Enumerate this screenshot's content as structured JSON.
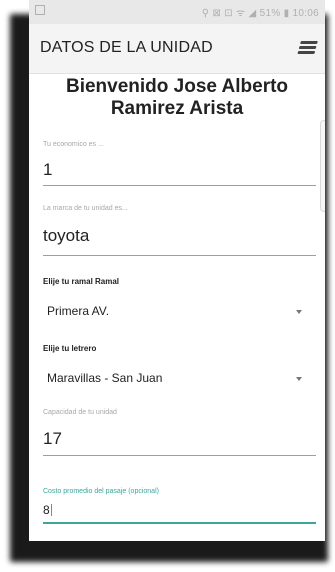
{
  "status_bar": {
    "right_text": "⚲ ⊠ ⊡ ᯤ ◢ 51% ▮ 10:06"
  },
  "app_bar": {
    "title": "DATOS DE LA UNIDAD",
    "menu_icon": "menu-icon"
  },
  "welcome": "Bienvenido Jose Alberto Ramirez Arista",
  "fields": {
    "economico": {
      "label": "Tu economico es ...",
      "value": "1"
    },
    "marca": {
      "label": "La marca de tu unidad es...",
      "value": "toyota"
    },
    "ramal": {
      "label": "Elije tu ramal Ramal",
      "value": "Primera AV."
    },
    "letrero": {
      "label": "Elije tu letrero",
      "value": "Maravillas - San Juan"
    },
    "capacidad": {
      "label": "Capacidad de tu unidad",
      "value": "17"
    },
    "costo": {
      "label": "Costo promedio del pasaje (opcional)",
      "value": "8"
    }
  },
  "colors": {
    "accent": "#3aa79b",
    "status_bar_bg": "#e8e8e8",
    "app_bar_bg": "#f4f4f4"
  }
}
